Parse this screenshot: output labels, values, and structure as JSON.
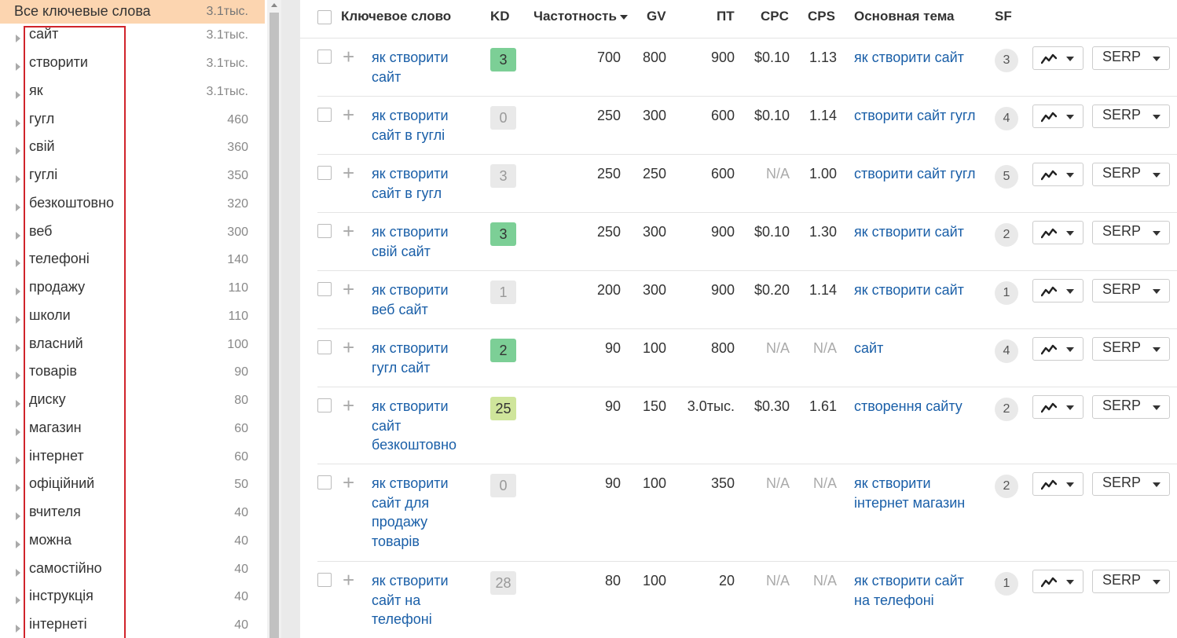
{
  "sidebar": {
    "header": {
      "label": "Все ключевые слова",
      "count": "3.1тыс."
    },
    "items": [
      {
        "label": "сайт",
        "count": "3.1тыс."
      },
      {
        "label": "створити",
        "count": "3.1тыс."
      },
      {
        "label": "як",
        "count": "3.1тыс."
      },
      {
        "label": "гугл",
        "count": "460"
      },
      {
        "label": "свій",
        "count": "360"
      },
      {
        "label": "гуглі",
        "count": "350"
      },
      {
        "label": "безкоштовно",
        "count": "320"
      },
      {
        "label": "веб",
        "count": "300"
      },
      {
        "label": "телефоні",
        "count": "140"
      },
      {
        "label": "продажу",
        "count": "110"
      },
      {
        "label": "школи",
        "count": "110"
      },
      {
        "label": "власний",
        "count": "100"
      },
      {
        "label": "товарів",
        "count": "90"
      },
      {
        "label": "диску",
        "count": "80"
      },
      {
        "label": "магазин",
        "count": "60"
      },
      {
        "label": "інтернет",
        "count": "60"
      },
      {
        "label": "офіційний",
        "count": "50"
      },
      {
        "label": "вчителя",
        "count": "40"
      },
      {
        "label": "можна",
        "count": "40"
      },
      {
        "label": "самостійно",
        "count": "40"
      },
      {
        "label": "інструкція",
        "count": "40"
      },
      {
        "label": "інтернеті",
        "count": "40"
      }
    ]
  },
  "table": {
    "headers": {
      "keyword": "Ключевое слово",
      "kd": "KD",
      "frequency": "Частотность",
      "gv": "GV",
      "tp": "ПТ",
      "cpc": "CPC",
      "cps": "CPS",
      "topic": "Основная тема",
      "sf": "SF"
    },
    "serp_label": "SERP",
    "rows": [
      {
        "keyword": "як створити сайт",
        "kd": "3",
        "kd_color": "#7ccf96",
        "frequency": "700",
        "gv": "800",
        "tp": "900",
        "cpc": "$0.10",
        "cps": "1.13",
        "topic": "як створити сайт",
        "sf": "3"
      },
      {
        "keyword": "як створити сайт в гуглі",
        "kd": "0",
        "kd_color": "#e9e9e9",
        "frequency": "250",
        "gv": "300",
        "tp": "600",
        "cpc": "$0.10",
        "cps": "1.14",
        "topic": "створити сайт гугл",
        "sf": "4"
      },
      {
        "keyword": "як створити сайт в гугл",
        "kd": "3",
        "kd_color": "#e9e9e9",
        "frequency": "250",
        "gv": "250",
        "tp": "600",
        "cpc": "N/A",
        "cps": "1.00",
        "topic": "створити сайт гугл",
        "sf": "5"
      },
      {
        "keyword": "як створити свій сайт",
        "kd": "3",
        "kd_color": "#7ccf96",
        "frequency": "250",
        "gv": "300",
        "tp": "900",
        "cpc": "$0.10",
        "cps": "1.30",
        "topic": "як створити сайт",
        "sf": "2"
      },
      {
        "keyword": "як створити веб сайт",
        "kd": "1",
        "kd_color": "#e9e9e9",
        "frequency": "200",
        "gv": "300",
        "tp": "900",
        "cpc": "$0.20",
        "cps": "1.14",
        "topic": "як створити сайт",
        "sf": "1"
      },
      {
        "keyword": "як створити гугл сайт",
        "kd": "2",
        "kd_color": "#7ccf96",
        "frequency": "90",
        "gv": "100",
        "tp": "800",
        "cpc": "N/A",
        "cps": "N/A",
        "topic": "сайт",
        "sf": "4"
      },
      {
        "keyword": "як створити сайт безкоштовно",
        "kd": "25",
        "kd_color": "#cfe59b",
        "frequency": "90",
        "gv": "150",
        "tp": "3.0тыс.",
        "cpc": "$0.30",
        "cps": "1.61",
        "topic": "створення сайту",
        "sf": "2"
      },
      {
        "keyword": "як створити сайт для продажу товарів",
        "kd": "0",
        "kd_color": "#e9e9e9",
        "frequency": "90",
        "gv": "100",
        "tp": "350",
        "cpc": "N/A",
        "cps": "N/A",
        "topic": "як створити інтернет магазин",
        "sf": "2"
      },
      {
        "keyword": "як створити сайт на телефоні",
        "kd": "28",
        "kd_color": "#e9e9e9",
        "frequency": "80",
        "gv": "100",
        "tp": "20",
        "cpc": "N/A",
        "cps": "N/A",
        "topic": "як створити сайт на телефоні",
        "sf": "1"
      }
    ]
  }
}
